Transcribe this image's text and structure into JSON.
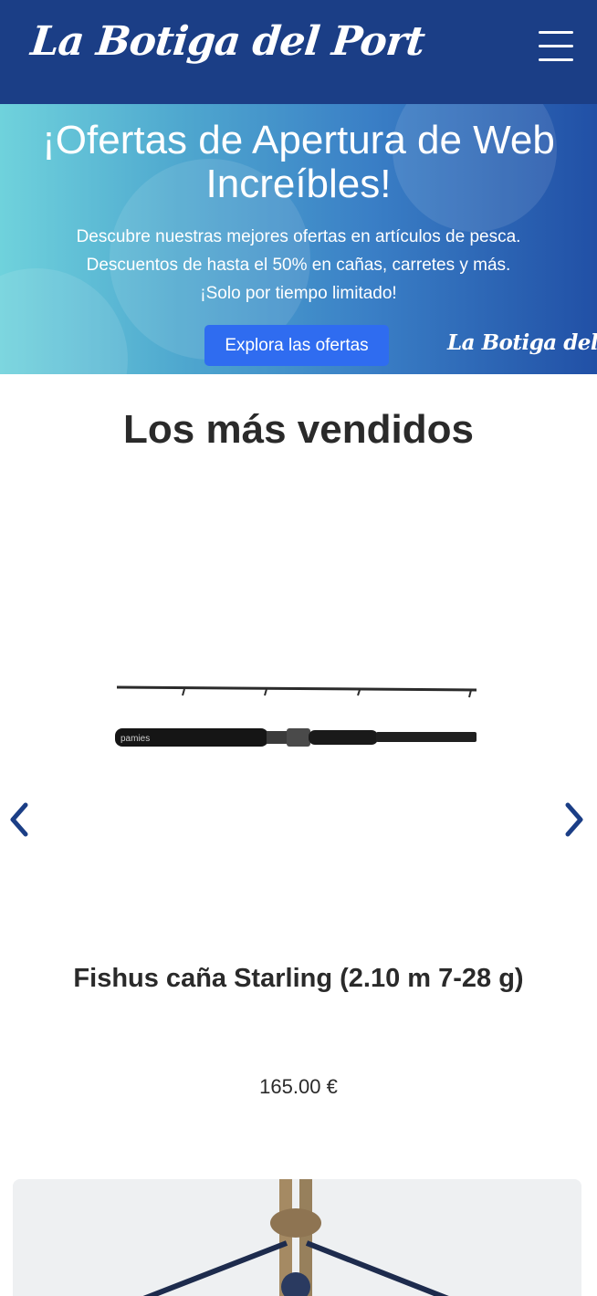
{
  "header": {
    "logo_text": "La Botiga del Port",
    "menu_icon": "hamburger-menu-icon"
  },
  "hero": {
    "title": "¡Ofertas de Apertura de Web Increíbles!",
    "line1": "Descubre nuestras mejores ofertas en artículos de pesca.",
    "line2": "Descuentos de hasta el 50% en cañas, carretes y más.",
    "line3": "¡Solo por tiempo limitado!",
    "button_label": "Explora las ofertas",
    "watermark_logo": "La Botiga del Port",
    "gradient_colors": [
      "#6fd2dc",
      "#2150a6"
    ],
    "button_color": "#2f6cf0"
  },
  "bestsellers": {
    "title": "Los más vendidos",
    "prev_icon": "chevron-left-icon",
    "next_icon": "chevron-right-icon",
    "product": {
      "name": "Fishus caña Starling (2.10 m 7-28 g)",
      "price": "165.00 €",
      "rod_brand": "pamies"
    }
  },
  "colors": {
    "header_bg": "#1b3e86",
    "arrow": "#1b3e86"
  }
}
